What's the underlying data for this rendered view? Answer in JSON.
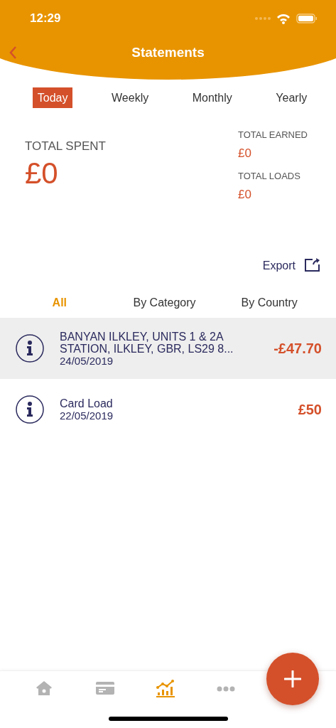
{
  "status_bar": {
    "time": "12:29"
  },
  "header": {
    "title": "Statements"
  },
  "period_tabs": [
    {
      "label": "Today",
      "selected": true
    },
    {
      "label": "Weekly",
      "selected": false
    },
    {
      "label": "Monthly",
      "selected": false
    },
    {
      "label": "Yearly",
      "selected": false
    }
  ],
  "summary": {
    "total_spent": {
      "label": "TOTAL SPENT",
      "value": "£0"
    },
    "total_earned": {
      "label": "TOTAL EARNED",
      "value": "£0"
    },
    "total_loads": {
      "label": "TOTAL LOADS",
      "value": "£0"
    }
  },
  "export": {
    "label": "Export"
  },
  "filter_tabs": [
    {
      "label": "All",
      "selected": true
    },
    {
      "label": "By Category",
      "selected": false
    },
    {
      "label": "By Country",
      "selected": false
    }
  ],
  "transactions": [
    {
      "description": "BANYAN ILKLEY, UNITS 1 & 2A STATION, ILKLEY, GBR, LS29 8...",
      "date": "24/05/2019",
      "amount": "-£47.70",
      "selected": true
    },
    {
      "description": "Card Load",
      "date": "22/05/2019",
      "amount": "£50",
      "selected": false
    }
  ],
  "bottom_nav": [
    {
      "kind": "home",
      "selected": false
    },
    {
      "kind": "card",
      "selected": false
    },
    {
      "kind": "chart",
      "selected": true
    },
    {
      "kind": "more",
      "selected": false
    }
  ]
}
